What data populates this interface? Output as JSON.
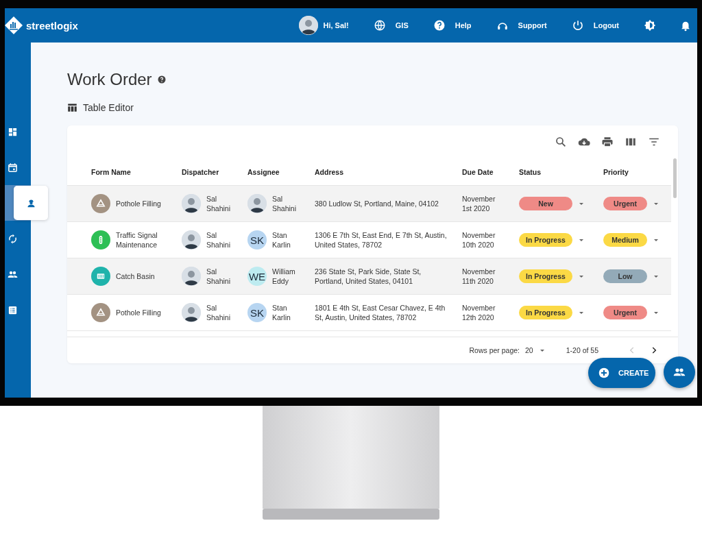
{
  "header": {
    "logo": "streetlogix",
    "greeting": "Hi, Sal!",
    "nav": [
      {
        "kind": "globe",
        "label": "GIS"
      },
      {
        "kind": "help",
        "label": "Help"
      },
      {
        "kind": "support",
        "label": "Support"
      },
      {
        "kind": "power",
        "label": "Logout"
      }
    ],
    "tools": [
      {
        "kind": "brightness"
      },
      {
        "kind": "bell"
      }
    ]
  },
  "sidebar": {
    "items": [
      {
        "kind": "dashboard",
        "selected": false
      },
      {
        "kind": "calendar",
        "selected": false
      },
      {
        "kind": "worker",
        "selected": true
      },
      {
        "kind": "sync",
        "selected": false
      },
      {
        "kind": "people",
        "selected": false
      },
      {
        "kind": "list",
        "selected": false
      }
    ]
  },
  "page": {
    "title": "Work Order",
    "section": "Table Editor"
  },
  "table": {
    "toolbar": [
      {
        "kind": "search"
      },
      {
        "kind": "download"
      },
      {
        "kind": "print"
      },
      {
        "kind": "columns"
      },
      {
        "kind": "filter"
      }
    ],
    "columns": [
      "Form Name",
      "Dispatcher",
      "Assignee",
      "Address",
      "Due Date",
      "Status",
      "Priority"
    ],
    "rows": [
      {
        "form": {
          "name": "Pothole Filling",
          "kind": "cone",
          "color": "#a39282"
        },
        "dispatcher": "Sal Shahini",
        "assignee": {
          "kind": "photo",
          "name": "Sal Shahini"
        },
        "address": "380 Ludlow St, Portland, Maine, 04102",
        "due": "November 1st 2020",
        "status": {
          "label": "New",
          "color": "#ef8a86"
        },
        "priority": {
          "label": "Urgent",
          "color": "#ef8a86"
        }
      },
      {
        "form": {
          "name": "Traffic Signal Maintenance",
          "kind": "signal",
          "color": "#2dbf55"
        },
        "dispatcher": "Sal Shahini",
        "assignee": {
          "kind": "initials",
          "initials": "SK",
          "color": "#b7d5f1",
          "name": "Stan Karlin"
        },
        "address": "1306 E 7th St, East End, E 7th St, Austin, United States, 78702",
        "due": "November 10th 2020",
        "status": {
          "label": "In Progress",
          "color": "#fbd945"
        },
        "priority": {
          "label": "Medium",
          "color": "#fbd945"
        }
      },
      {
        "form": {
          "name": "Catch Basin",
          "kind": "grate",
          "color": "#1fb3ab"
        },
        "dispatcher": "Sal Shahini",
        "assignee": {
          "kind": "initials",
          "initials": "WE",
          "color": "#bdebf0",
          "name": "William Eddy"
        },
        "address": "236 State St, Park Side, State St, Portland, United States, 04101",
        "due": "November 11th 2020",
        "status": {
          "label": "In Progress",
          "color": "#fbd945"
        },
        "priority": {
          "label": "Low",
          "color": "#93aab8"
        }
      },
      {
        "form": {
          "name": "Pothole Filling",
          "kind": "cone",
          "color": "#a39282"
        },
        "dispatcher": "Sal Shahini",
        "assignee": {
          "kind": "initials",
          "initials": "SK",
          "color": "#b7d5f1",
          "name": "Stan Karlin"
        },
        "address": "1801 E 4th St, East Cesar Chavez, E 4th St, Austin, United States, 78702",
        "due": "November 12th 2020",
        "status": {
          "label": "In Progress",
          "color": "#fbd945"
        },
        "priority": {
          "label": "Urgent",
          "color": "#ef8a86"
        }
      }
    ],
    "footer": {
      "rows_label": "Rows per page:",
      "rows_value": "20",
      "range": "1-20 of 55",
      "prev": {
        "disabled": true
      },
      "next": {
        "disabled": false
      }
    }
  },
  "actions": {
    "create": "CREATE"
  }
}
